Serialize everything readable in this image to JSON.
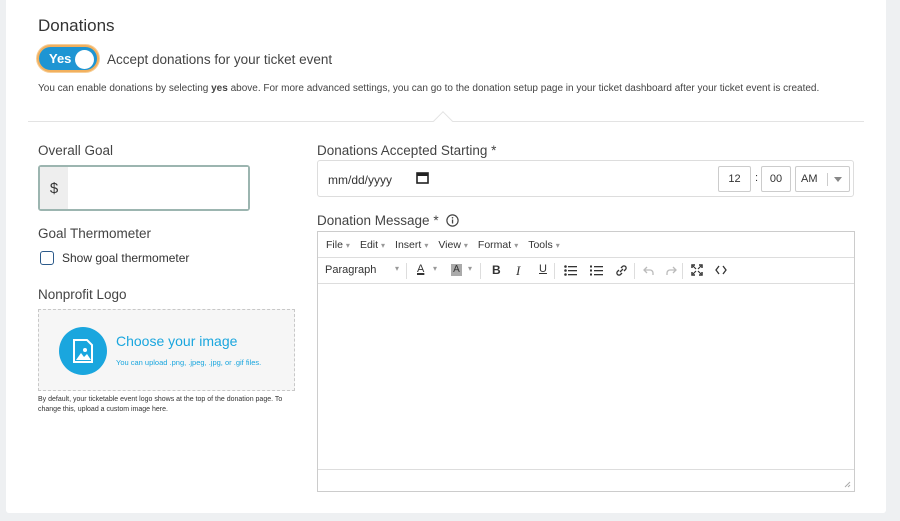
{
  "section": {
    "title": "Donations",
    "toggle_label": "Yes",
    "toggle_text": "Accept donations for your ticket event",
    "help_prefix": "You can enable donations by selecting ",
    "help_bold": "yes",
    "help_suffix": " above. For more advanced settings, you can go to the donation setup page in your ticket dashboard after your ticket event is created."
  },
  "goal": {
    "label": "Overall Goal",
    "prefix": "$",
    "value": ""
  },
  "thermometer": {
    "label": "Goal Thermometer",
    "checkbox_label": "Show goal thermometer",
    "checked": false
  },
  "logo": {
    "label": "Nonprofit Logo",
    "choose": "Choose your image",
    "formats": "You can upload .png, .jpeg, .jpg, or .gif files.",
    "note": "By default, your ticketable event logo shows at the top of the donation page. To change this, upload a custom image here."
  },
  "starting": {
    "label": "Donations Accepted Starting *",
    "date_placeholder": "mm/dd/yyyy",
    "hour": "12",
    "minute": "00",
    "ampm": "AM"
  },
  "message": {
    "label": "Donation Message *",
    "menu": [
      "File",
      "Edit",
      "Insert",
      "View",
      "Format",
      "Tools"
    ],
    "block_format": "Paragraph",
    "content": ""
  },
  "colors": {
    "accent": "#1aa6de",
    "toggle_bg": "#1e95d3",
    "toggle_ring": "#f2b05e"
  }
}
